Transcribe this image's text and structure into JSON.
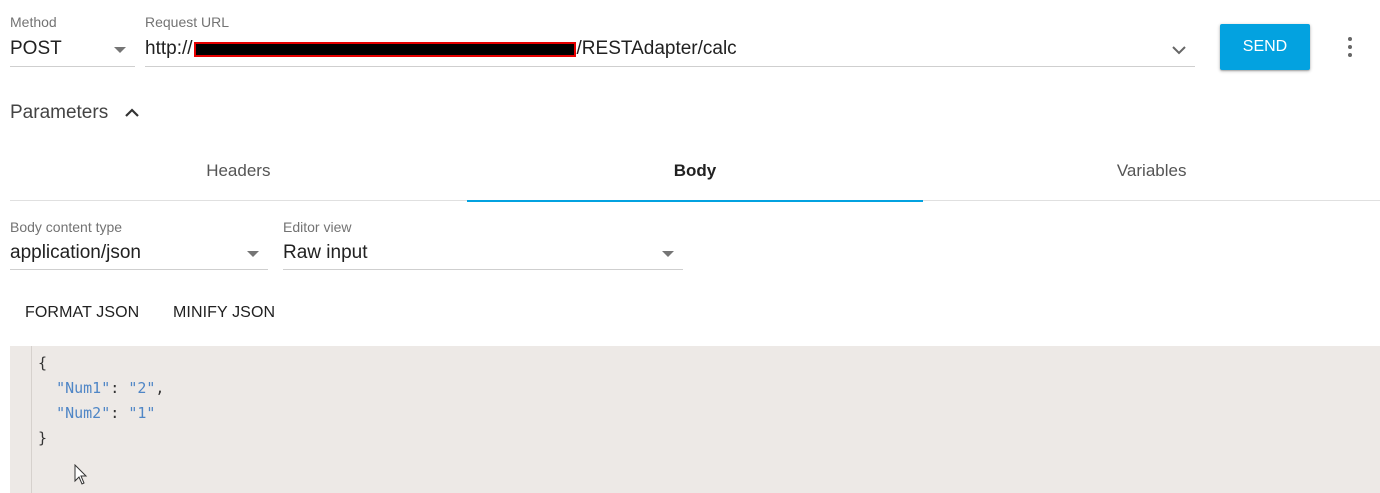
{
  "method": {
    "label": "Method",
    "value": "POST"
  },
  "request_url": {
    "label": "Request URL",
    "prefix": "http://",
    "suffix": "/RESTAdapter/calc"
  },
  "send_label": "SEND",
  "parameters": {
    "title": "Parameters"
  },
  "tabs": [
    {
      "label": "Headers",
      "active": false
    },
    {
      "label": "Body",
      "active": true
    },
    {
      "label": "Variables",
      "active": false
    }
  ],
  "body_content_type": {
    "label": "Body content type",
    "value": "application/json"
  },
  "editor_view": {
    "label": "Editor view",
    "value": "Raw input"
  },
  "actions": {
    "format": "FORMAT JSON",
    "minify": "MINIFY JSON"
  },
  "code": {
    "open": "{",
    "close": "}",
    "lines": [
      {
        "key": "\"Num1\"",
        "sep": ": ",
        "value": "\"2\"",
        "end": ","
      },
      {
        "key": "\"Num2\"",
        "sep": ": ",
        "value": "\"1\"",
        "end": ""
      }
    ]
  },
  "colors": {
    "accent": "#03a2e0",
    "editor_bg": "#ede9e6",
    "json_string": "#4f86c6"
  }
}
